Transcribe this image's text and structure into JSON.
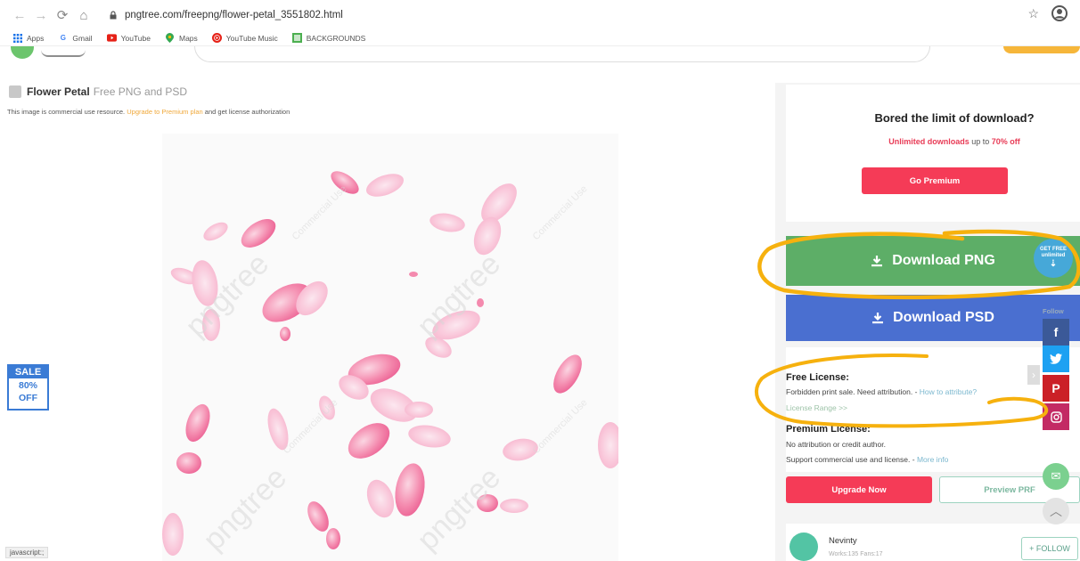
{
  "browser": {
    "url": "pngtree.com/freepng/flower-petal_3551802.html",
    "bookmarks": [
      "Apps",
      "Gmail",
      "YouTube",
      "Maps",
      "YouTube Music",
      "BACKGROUNDS"
    ]
  },
  "page": {
    "title_main": "Flower Petal",
    "title_sub": "Free PNG and PSD",
    "notice_prefix": "This image is commercial use resource.",
    "notice_link": "Upgrade to Premium plan",
    "notice_suffix": "and get license authorization",
    "watermark": "pngtree",
    "watermark_sub": "Commercial Use"
  },
  "sale_badge": {
    "line1": "SALE",
    "line2": "80%",
    "line3": "OFF"
  },
  "status_bar": "javascript:;",
  "sidebar": {
    "promo_heading": "Bored the limit of download?",
    "promo_unlimited": "Unlimited downloads",
    "promo_mid": "up to",
    "promo_pct": "70% off",
    "go_premium": "Go Premium",
    "download_png": "Download PNG",
    "download_psd": "Download PSD",
    "free_badge_1": "GET FREE",
    "free_badge_2": "unlimited",
    "free_license_heading": "Free License:",
    "free_license_text": "Forbidden print sale. Need attribution. -",
    "how_to_attribute": "How to attribute?",
    "license_range": "License Range >>",
    "premium_heading": "Premium License:",
    "premium_line1": "No attribution or credit author.",
    "premium_line2": "Support commercial use and license. -",
    "more_info": "More info",
    "upgrade_now": "Upgrade Now",
    "preview_prf": "Preview PRF",
    "author_name": "Nevinty",
    "author_stats": "Works:135 Fans:17",
    "follow": "+ FOLLOW",
    "social_label": "Follow"
  },
  "colors": {
    "green": "#5dae67",
    "blue": "#4a6fd0",
    "red": "#f53b57",
    "annotation": "#f6b10e"
  },
  "icons": [
    "back-icon",
    "forward-icon",
    "reload-icon",
    "home-icon",
    "lock-icon",
    "star-icon",
    "account-icon",
    "download-icon",
    "facebook-icon",
    "twitter-icon",
    "pinterest-icon",
    "instagram-icon",
    "mail-icon",
    "scroll-up-icon"
  ]
}
